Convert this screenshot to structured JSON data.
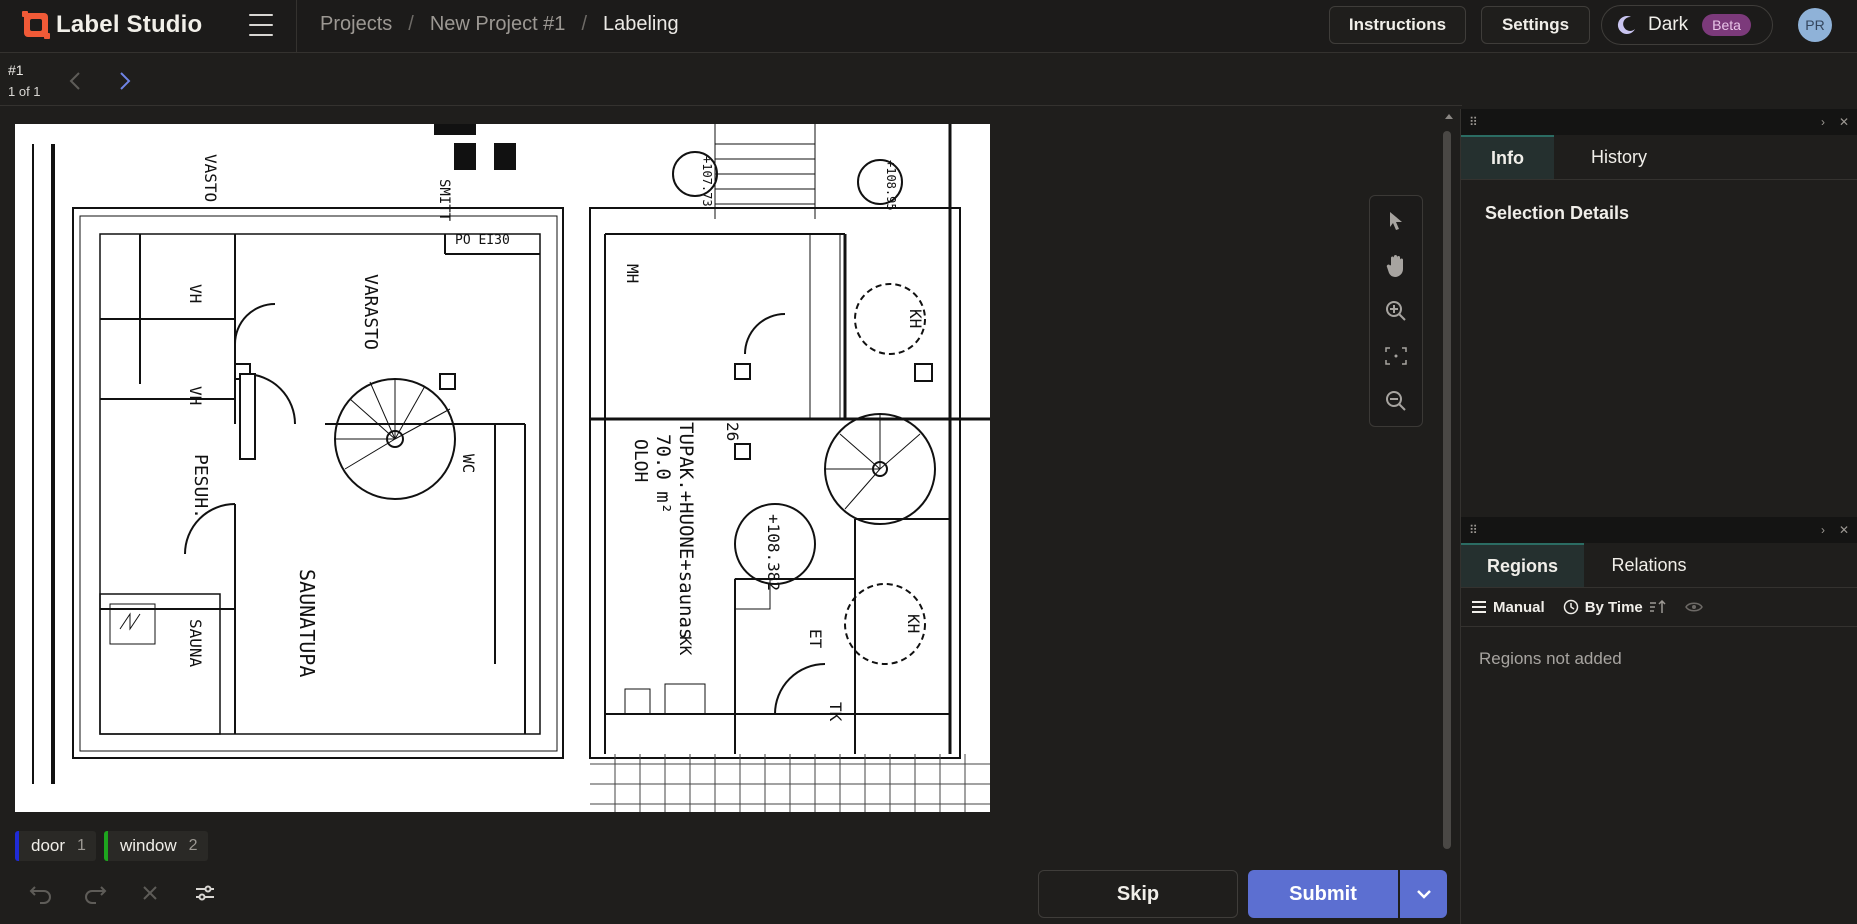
{
  "app": {
    "name": "Label Studio"
  },
  "breadcrumb": {
    "items": [
      "Projects",
      "New Project #1",
      "Labeling"
    ],
    "separator": "/"
  },
  "header": {
    "instructions_label": "Instructions",
    "settings_label": "Settings",
    "theme_label": "Dark",
    "beta_label": "Beta",
    "avatar_initials": "PR"
  },
  "task": {
    "id_label": "#1",
    "count_label": "1 of 1"
  },
  "labels": [
    {
      "name": "door",
      "count": "1",
      "color": "#1f2bd6"
    },
    {
      "name": "window",
      "count": "2",
      "color": "#1ea51e"
    }
  ],
  "actions": {
    "skip_label": "Skip",
    "submit_label": "Submit"
  },
  "info_panel": {
    "tabs": [
      "Info",
      "History"
    ],
    "title": "Selection Details"
  },
  "regions_panel": {
    "tabs": [
      "Regions",
      "Relations"
    ],
    "manual_label": "Manual",
    "sort_label": "By Time",
    "empty_text": "Regions not added"
  },
  "floorplan": {
    "room_labels": [
      "VARASTO",
      "PO EI30",
      "VH",
      "VH",
      "WC",
      "PESUH.",
      "SAUNATUPA",
      "SAUNA",
      "MH",
      "KH",
      "26",
      "TUPAK.+HUONE+saunas",
      "KK",
      "70.0 m²",
      "OLOH",
      "+108.382",
      "ET",
      "KH",
      "TK",
      "+107.73",
      "+108.95",
      "VASTO",
      "SMITT"
    ]
  },
  "colors": {
    "accent": "#5c6fd1",
    "background": "#1f1e1c",
    "logo": "#f05a37"
  }
}
